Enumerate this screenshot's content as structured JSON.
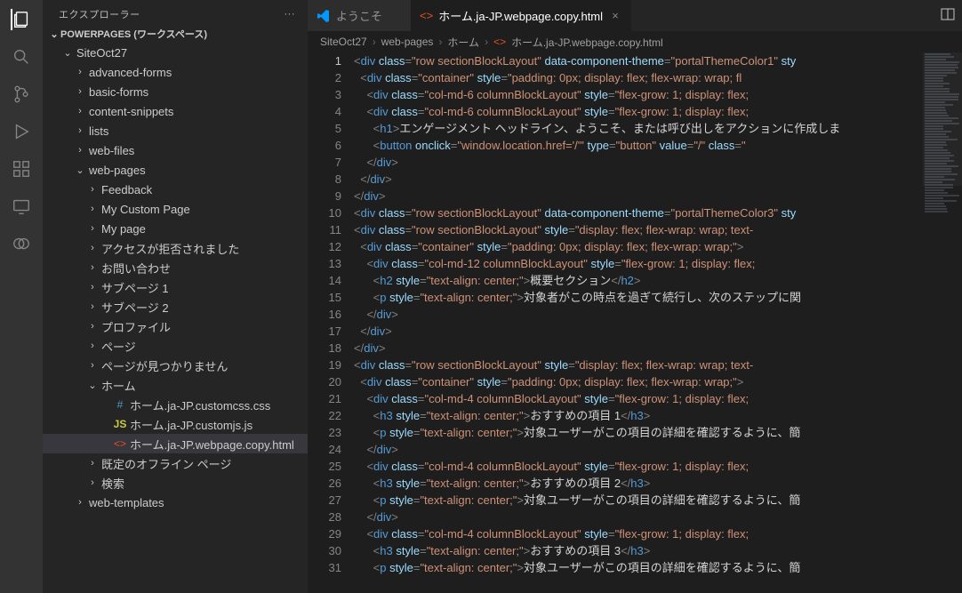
{
  "sidebar": {
    "title": "エクスプローラー",
    "workspace": "POWERPAGES (ワークスペース)"
  },
  "tree": [
    {
      "depth": 1,
      "chev": "v",
      "icon": "",
      "label": "SiteOct27"
    },
    {
      "depth": 2,
      "chev": ">",
      "icon": "",
      "label": "advanced-forms"
    },
    {
      "depth": 2,
      "chev": ">",
      "icon": "",
      "label": "basic-forms"
    },
    {
      "depth": 2,
      "chev": ">",
      "icon": "",
      "label": "content-snippets"
    },
    {
      "depth": 2,
      "chev": ">",
      "icon": "",
      "label": "lists"
    },
    {
      "depth": 2,
      "chev": ">",
      "icon": "",
      "label": "web-files"
    },
    {
      "depth": 2,
      "chev": "v",
      "icon": "",
      "label": "web-pages"
    },
    {
      "depth": 3,
      "chev": ">",
      "icon": "",
      "label": "Feedback"
    },
    {
      "depth": 3,
      "chev": ">",
      "icon": "",
      "label": "My Custom Page"
    },
    {
      "depth": 3,
      "chev": ">",
      "icon": "",
      "label": "My page"
    },
    {
      "depth": 3,
      "chev": ">",
      "icon": "",
      "label": "アクセスが拒否されました"
    },
    {
      "depth": 3,
      "chev": ">",
      "icon": "",
      "label": "お問い合わせ"
    },
    {
      "depth": 3,
      "chev": ">",
      "icon": "",
      "label": "サブページ 1"
    },
    {
      "depth": 3,
      "chev": ">",
      "icon": "",
      "label": "サブページ 2"
    },
    {
      "depth": 3,
      "chev": ">",
      "icon": "",
      "label": "プロファイル"
    },
    {
      "depth": 3,
      "chev": ">",
      "icon": "",
      "label": "ページ"
    },
    {
      "depth": 3,
      "chev": ">",
      "icon": "",
      "label": "ページが見つかりません"
    },
    {
      "depth": 3,
      "chev": "v",
      "icon": "",
      "label": "ホーム"
    },
    {
      "depth": 4,
      "chev": "",
      "icon": "#",
      "iclass": "fic-css",
      "label": "ホーム.ja-JP.customcss.css"
    },
    {
      "depth": 4,
      "chev": "",
      "icon": "JS",
      "iclass": "fic-js",
      "label": "ホーム.ja-JP.customjs.js"
    },
    {
      "depth": 4,
      "chev": "",
      "icon": "<>",
      "iclass": "fic-html",
      "label": "ホーム.ja-JP.webpage.copy.html",
      "selected": true
    },
    {
      "depth": 3,
      "chev": ">",
      "icon": "",
      "label": "既定のオフライン ページ"
    },
    {
      "depth": 3,
      "chev": ">",
      "icon": "",
      "label": "検索"
    },
    {
      "depth": 2,
      "chev": ">",
      "icon": "",
      "label": "web-templates"
    }
  ],
  "tabs": [
    {
      "icon": "vs",
      "iclass": "fic-html",
      "label": "ようこそ",
      "active": false,
      "close": ""
    },
    {
      "icon": "<>",
      "iclass": "fic-html",
      "label": "ホーム.ja-JP.webpage.copy.html",
      "active": true,
      "close": "×"
    }
  ],
  "crumbs": [
    "SiteOct27",
    "web-pages",
    "ホーム",
    "ホーム.ja-JP.webpage.copy.html"
  ],
  "crumb_icon": "<>",
  "lineCount": 31,
  "currentLine": 1,
  "code_lines": [
    [
      [
        "pun",
        "<"
      ],
      [
        "tag",
        "div "
      ],
      [
        "attr",
        "class"
      ],
      [
        "pun",
        "="
      ],
      [
        "str",
        "\"row sectionBlockLayout\""
      ],
      [
        "tag",
        " "
      ],
      [
        "attr",
        "data-component-theme"
      ],
      [
        "pun",
        "="
      ],
      [
        "str",
        "\"portalThemeColor1\""
      ],
      [
        "tag",
        " "
      ],
      [
        "attr",
        "sty"
      ]
    ],
    [
      [
        "txt",
        "  "
      ],
      [
        "pun",
        "<"
      ],
      [
        "tag",
        "div "
      ],
      [
        "attr",
        "class"
      ],
      [
        "pun",
        "="
      ],
      [
        "str",
        "\"container\""
      ],
      [
        "tag",
        " "
      ],
      [
        "attr",
        "style"
      ],
      [
        "pun",
        "="
      ],
      [
        "str",
        "\"padding: 0px; display: flex; flex-wrap: wrap; fl"
      ]
    ],
    [
      [
        "txt",
        "    "
      ],
      [
        "pun",
        "<"
      ],
      [
        "tag",
        "div "
      ],
      [
        "attr",
        "class"
      ],
      [
        "pun",
        "="
      ],
      [
        "str",
        "\"col-md-6 columnBlockLayout\""
      ],
      [
        "tag",
        " "
      ],
      [
        "attr",
        "style"
      ],
      [
        "pun",
        "="
      ],
      [
        "str",
        "\"flex-grow: 1; display: flex;"
      ]
    ],
    [
      [
        "txt",
        "    "
      ],
      [
        "pun",
        "<"
      ],
      [
        "tag",
        "div "
      ],
      [
        "attr",
        "class"
      ],
      [
        "pun",
        "="
      ],
      [
        "str",
        "\"col-md-6 columnBlockLayout\""
      ],
      [
        "tag",
        " "
      ],
      [
        "attr",
        "style"
      ],
      [
        "pun",
        "="
      ],
      [
        "str",
        "\"flex-grow: 1; display: flex;"
      ]
    ],
    [
      [
        "txt",
        "      "
      ],
      [
        "pun",
        "<"
      ],
      [
        "tag",
        "h1"
      ],
      [
        "pun",
        ">"
      ],
      [
        "txt",
        "エンゲージメント ヘッドライン、ようこそ、または呼び出しをアクションに作成しま"
      ]
    ],
    [
      [
        "txt",
        "      "
      ],
      [
        "pun",
        "<"
      ],
      [
        "tag",
        "button "
      ],
      [
        "attr",
        "onclick"
      ],
      [
        "pun",
        "="
      ],
      [
        "str",
        "\"window.location.href='/'\""
      ],
      [
        "tag",
        " "
      ],
      [
        "attr",
        "type"
      ],
      [
        "pun",
        "="
      ],
      [
        "str",
        "\"button\""
      ],
      [
        "tag",
        " "
      ],
      [
        "attr",
        "value"
      ],
      [
        "pun",
        "="
      ],
      [
        "str",
        "\"/\""
      ],
      [
        "tag",
        " "
      ],
      [
        "attr",
        "class"
      ],
      [
        "pun",
        "="
      ],
      [
        "str",
        "\""
      ]
    ],
    [
      [
        "txt",
        "    "
      ],
      [
        "pun",
        "</"
      ],
      [
        "tag",
        "div"
      ],
      [
        "pun",
        ">"
      ]
    ],
    [
      [
        "txt",
        "  "
      ],
      [
        "pun",
        "</"
      ],
      [
        "tag",
        "div"
      ],
      [
        "pun",
        ">"
      ]
    ],
    [
      [
        "pun",
        "</"
      ],
      [
        "tag",
        "div"
      ],
      [
        "pun",
        ">"
      ]
    ],
    [
      [
        "pun",
        "<"
      ],
      [
        "tag",
        "div "
      ],
      [
        "attr",
        "class"
      ],
      [
        "pun",
        "="
      ],
      [
        "str",
        "\"row sectionBlockLayout\""
      ],
      [
        "tag",
        " "
      ],
      [
        "attr",
        "data-component-theme"
      ],
      [
        "pun",
        "="
      ],
      [
        "str",
        "\"portalThemeColor3\""
      ],
      [
        "tag",
        " "
      ],
      [
        "attr",
        "sty"
      ]
    ],
    [
      [
        "pun",
        "<"
      ],
      [
        "tag",
        "div "
      ],
      [
        "attr",
        "class"
      ],
      [
        "pun",
        "="
      ],
      [
        "str",
        "\"row sectionBlockLayout\""
      ],
      [
        "tag",
        " "
      ],
      [
        "attr",
        "style"
      ],
      [
        "pun",
        "="
      ],
      [
        "str",
        "\"display: flex; flex-wrap: wrap; text-"
      ]
    ],
    [
      [
        "txt",
        "  "
      ],
      [
        "pun",
        "<"
      ],
      [
        "tag",
        "div "
      ],
      [
        "attr",
        "class"
      ],
      [
        "pun",
        "="
      ],
      [
        "str",
        "\"container\""
      ],
      [
        "tag",
        " "
      ],
      [
        "attr",
        "style"
      ],
      [
        "pun",
        "="
      ],
      [
        "str",
        "\"padding: 0px; display: flex; flex-wrap: wrap;\""
      ],
      [
        "pun",
        ">"
      ]
    ],
    [
      [
        "txt",
        "    "
      ],
      [
        "pun",
        "<"
      ],
      [
        "tag",
        "div "
      ],
      [
        "attr",
        "class"
      ],
      [
        "pun",
        "="
      ],
      [
        "str",
        "\"col-md-12 columnBlockLayout\""
      ],
      [
        "tag",
        " "
      ],
      [
        "attr",
        "style"
      ],
      [
        "pun",
        "="
      ],
      [
        "str",
        "\"flex-grow: 1; display: flex;"
      ]
    ],
    [
      [
        "txt",
        "      "
      ],
      [
        "pun",
        "<"
      ],
      [
        "tag",
        "h2 "
      ],
      [
        "attr",
        "style"
      ],
      [
        "pun",
        "="
      ],
      [
        "str",
        "\"text-align: center;\""
      ],
      [
        "pun",
        ">"
      ],
      [
        "txt",
        "概要セクション"
      ],
      [
        "pun",
        "</"
      ],
      [
        "tag",
        "h2"
      ],
      [
        "pun",
        ">"
      ]
    ],
    [
      [
        "txt",
        "      "
      ],
      [
        "pun",
        "<"
      ],
      [
        "tag",
        "p "
      ],
      [
        "attr",
        "style"
      ],
      [
        "pun",
        "="
      ],
      [
        "str",
        "\"text-align: center;\""
      ],
      [
        "pun",
        ">"
      ],
      [
        "txt",
        "対象者がこの時点を過ぎて続行し、次のステップに関"
      ]
    ],
    [
      [
        "txt",
        "    "
      ],
      [
        "pun",
        "</"
      ],
      [
        "tag",
        "div"
      ],
      [
        "pun",
        ">"
      ]
    ],
    [
      [
        "txt",
        "  "
      ],
      [
        "pun",
        "</"
      ],
      [
        "tag",
        "div"
      ],
      [
        "pun",
        ">"
      ]
    ],
    [
      [
        "pun",
        "</"
      ],
      [
        "tag",
        "div"
      ],
      [
        "pun",
        ">"
      ]
    ],
    [
      [
        "pun",
        "<"
      ],
      [
        "tag",
        "div "
      ],
      [
        "attr",
        "class"
      ],
      [
        "pun",
        "="
      ],
      [
        "str",
        "\"row sectionBlockLayout\""
      ],
      [
        "tag",
        " "
      ],
      [
        "attr",
        "style"
      ],
      [
        "pun",
        "="
      ],
      [
        "str",
        "\"display: flex; flex-wrap: wrap; text-"
      ]
    ],
    [
      [
        "txt",
        "  "
      ],
      [
        "pun",
        "<"
      ],
      [
        "tag",
        "div "
      ],
      [
        "attr",
        "class"
      ],
      [
        "pun",
        "="
      ],
      [
        "str",
        "\"container\""
      ],
      [
        "tag",
        " "
      ],
      [
        "attr",
        "style"
      ],
      [
        "pun",
        "="
      ],
      [
        "str",
        "\"padding: 0px; display: flex; flex-wrap: wrap;\""
      ],
      [
        "pun",
        ">"
      ]
    ],
    [
      [
        "txt",
        "    "
      ],
      [
        "pun",
        "<"
      ],
      [
        "tag",
        "div "
      ],
      [
        "attr",
        "class"
      ],
      [
        "pun",
        "="
      ],
      [
        "str",
        "\"col-md-4 columnBlockLayout\""
      ],
      [
        "tag",
        " "
      ],
      [
        "attr",
        "style"
      ],
      [
        "pun",
        "="
      ],
      [
        "str",
        "\"flex-grow: 1; display: flex;"
      ]
    ],
    [
      [
        "txt",
        "      "
      ],
      [
        "pun",
        "<"
      ],
      [
        "tag",
        "h3 "
      ],
      [
        "attr",
        "style"
      ],
      [
        "pun",
        "="
      ],
      [
        "str",
        "\"text-align: center;\""
      ],
      [
        "pun",
        ">"
      ],
      [
        "txt",
        "おすすめの項目 1"
      ],
      [
        "pun",
        "</"
      ],
      [
        "tag",
        "h3"
      ],
      [
        "pun",
        ">"
      ]
    ],
    [
      [
        "txt",
        "      "
      ],
      [
        "pun",
        "<"
      ],
      [
        "tag",
        "p "
      ],
      [
        "attr",
        "style"
      ],
      [
        "pun",
        "="
      ],
      [
        "str",
        "\"text-align: center;\""
      ],
      [
        "pun",
        ">"
      ],
      [
        "txt",
        "対象ユーザーがこの項目の詳細を確認するように、簡"
      ]
    ],
    [
      [
        "txt",
        "    "
      ],
      [
        "pun",
        "</"
      ],
      [
        "tag",
        "div"
      ],
      [
        "pun",
        ">"
      ]
    ],
    [
      [
        "txt",
        "    "
      ],
      [
        "pun",
        "<"
      ],
      [
        "tag",
        "div "
      ],
      [
        "attr",
        "class"
      ],
      [
        "pun",
        "="
      ],
      [
        "str",
        "\"col-md-4 columnBlockLayout\""
      ],
      [
        "tag",
        " "
      ],
      [
        "attr",
        "style"
      ],
      [
        "pun",
        "="
      ],
      [
        "str",
        "\"flex-grow: 1; display: flex;"
      ]
    ],
    [
      [
        "txt",
        "      "
      ],
      [
        "pun",
        "<"
      ],
      [
        "tag",
        "h3 "
      ],
      [
        "attr",
        "style"
      ],
      [
        "pun",
        "="
      ],
      [
        "str",
        "\"text-align: center;\""
      ],
      [
        "pun",
        ">"
      ],
      [
        "txt",
        "おすすめの項目 2"
      ],
      [
        "pun",
        "</"
      ],
      [
        "tag",
        "h3"
      ],
      [
        "pun",
        ">"
      ]
    ],
    [
      [
        "txt",
        "      "
      ],
      [
        "pun",
        "<"
      ],
      [
        "tag",
        "p "
      ],
      [
        "attr",
        "style"
      ],
      [
        "pun",
        "="
      ],
      [
        "str",
        "\"text-align: center;\""
      ],
      [
        "pun",
        ">"
      ],
      [
        "txt",
        "対象ユーザーがこの項目の詳細を確認するように、簡"
      ]
    ],
    [
      [
        "txt",
        "    "
      ],
      [
        "pun",
        "</"
      ],
      [
        "tag",
        "div"
      ],
      [
        "pun",
        ">"
      ]
    ],
    [
      [
        "txt",
        "    "
      ],
      [
        "pun",
        "<"
      ],
      [
        "tag",
        "div "
      ],
      [
        "attr",
        "class"
      ],
      [
        "pun",
        "="
      ],
      [
        "str",
        "\"col-md-4 columnBlockLayout\""
      ],
      [
        "tag",
        " "
      ],
      [
        "attr",
        "style"
      ],
      [
        "pun",
        "="
      ],
      [
        "str",
        "\"flex-grow: 1; display: flex;"
      ]
    ],
    [
      [
        "txt",
        "      "
      ],
      [
        "pun",
        "<"
      ],
      [
        "tag",
        "h3 "
      ],
      [
        "attr",
        "style"
      ],
      [
        "pun",
        "="
      ],
      [
        "str",
        "\"text-align: center;\""
      ],
      [
        "pun",
        ">"
      ],
      [
        "txt",
        "おすすめの項目 3"
      ],
      [
        "pun",
        "</"
      ],
      [
        "tag",
        "h3"
      ],
      [
        "pun",
        ">"
      ]
    ],
    [
      [
        "txt",
        "      "
      ],
      [
        "pun",
        "<"
      ],
      [
        "tag",
        "p "
      ],
      [
        "attr",
        "style"
      ],
      [
        "pun",
        "="
      ],
      [
        "str",
        "\"text-align: center;\""
      ],
      [
        "pun",
        ">"
      ],
      [
        "txt",
        "対象ユーザーがこの項目の詳細を確認するように、簡"
      ]
    ]
  ]
}
